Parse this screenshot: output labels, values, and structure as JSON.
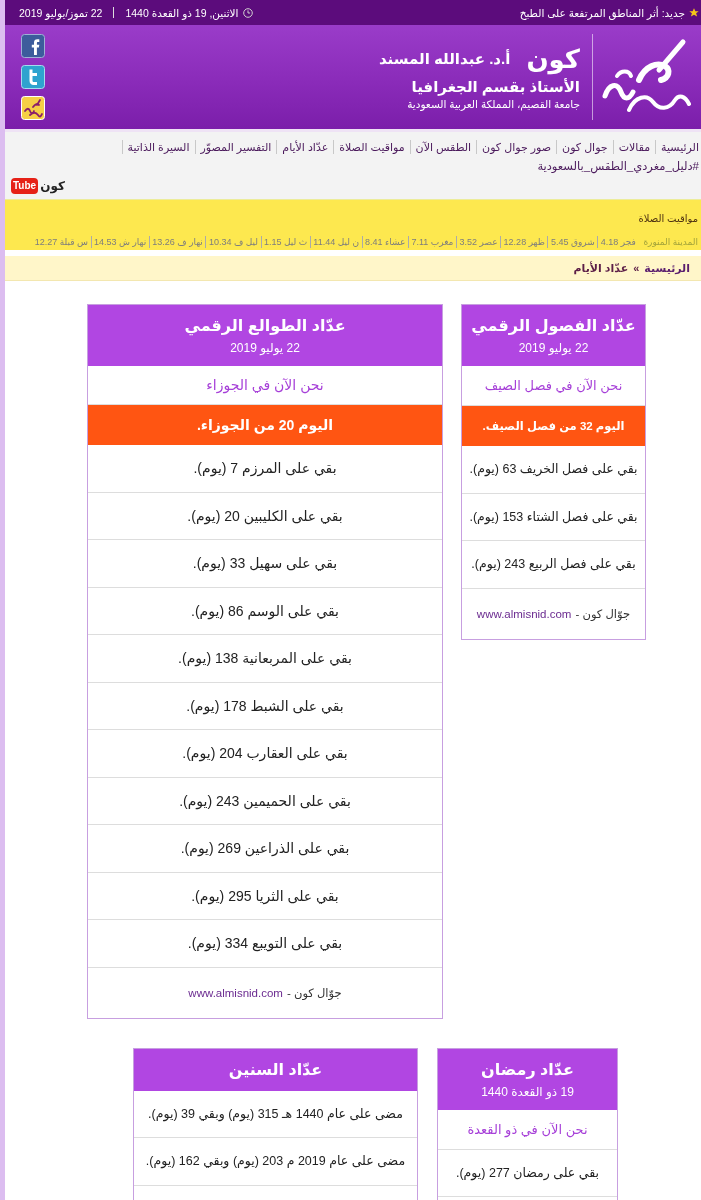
{
  "top_bar": {
    "news": "جديد: أثر المناطق المرتفعة على الطبخ",
    "hijri_date": "الاثنين, 19 ذو القعدة 1440",
    "gregorian_date": "22 تموز/يوليو 2019"
  },
  "header": {
    "brand": "كون",
    "name": "أ.د. عبدالله المسند",
    "title": "الأستاذ بقسم الجغرافيا",
    "affiliation": "جامعة القصيم، المملكة العربية السعودية"
  },
  "nav": {
    "items": [
      "الرئيسية",
      "مقالات",
      "جوال كون",
      "صور جوال كون",
      "الطقس الآن",
      "مواقيت الصلاة",
      "عدّاد الأيام",
      "التفسير المصوّر",
      "السيرة الذاتية"
    ],
    "hashtag": "#دليل_مغردي_الطقس_بالسعودية",
    "youtube": {
      "label": "كون",
      "badge": "Tube"
    }
  },
  "prayer_times": {
    "title": "مواقيت الصلاة",
    "city": "المدينة المنورة",
    "times": [
      "فجر 4.18",
      "شروق 5.45",
      "ظهر 12.28",
      "عصر 3.52",
      "مغرب 7.11",
      "عشاء 8.41",
      "ن ليل 11.44",
      "ث ليل 1.15",
      "ليل ف 10.34",
      "نهار ف 13.26",
      "نهار ش 14.53",
      "س قبلة 12.27"
    ]
  },
  "breadcrumb": {
    "items": [
      "الرئيسية",
      "عدّاد الأيام"
    ],
    "separator": "»"
  },
  "counter_rows": [
    {
      "cards": [
        {
          "title": "عدّاد الفصول الرقمي",
          "date": "22 يوليو 2019",
          "current": "نحن الآن في فصل الصيف",
          "today": "اليوم 32 من فصل الصيف.",
          "remaining": [
            "بقي على فصل الخريف 63 (يوم).",
            "بقي على فصل الشتاء 153 (يوم).",
            "بقي على فصل الربيع 243 (يوم)."
          ],
          "footer": {
            "text": "جوّال كون -",
            "link": "www.almisnid.com"
          }
        },
        {
          "title": "عدّاد الطوالع الرقمي",
          "date": "22 يوليو 2019",
          "current": "نحن الآن في الجوزاء",
          "today": "اليوم 20 من الجوزاء.",
          "remaining": [
            "بقي على المرزم 7 (يوم).",
            "بقي على الكليبين 20 (يوم).",
            "بقي على سهيل 33 (يوم).",
            "بقي على الوسم 86 (يوم).",
            "بقي على المربعانية 138 (يوم).",
            "بقي على الشبط 178 (يوم).",
            "بقي على العقارب 204 (يوم).",
            "بقي على الحميمين 243 (يوم).",
            "بقي على الذراعين 269 (يوم).",
            "بقي على الثريا 295 (يوم).",
            "بقي على التويبع 334 (يوم)."
          ],
          "footer": {
            "text": "جوّال كون -",
            "link": "www.almisnid.com"
          }
        }
      ]
    },
    {
      "cards": [
        {
          "title": "عدّاد رمضان",
          "date": "19 ذو القعدة 1440",
          "current": "نحن الآن في ذو القعدة",
          "remaining": [
            "بقي على رمضان 277 (يوم)."
          ]
        },
        {
          "title": "عدّاد السنين",
          "remaining": [
            "مضى على عام 1440 هـ 315 (يوم) وبقي 39 (يوم).",
            "مضى على عام 2019 م 203 (يوم) وبقي 162 (يوم)."
          ]
        }
      ]
    }
  ]
}
